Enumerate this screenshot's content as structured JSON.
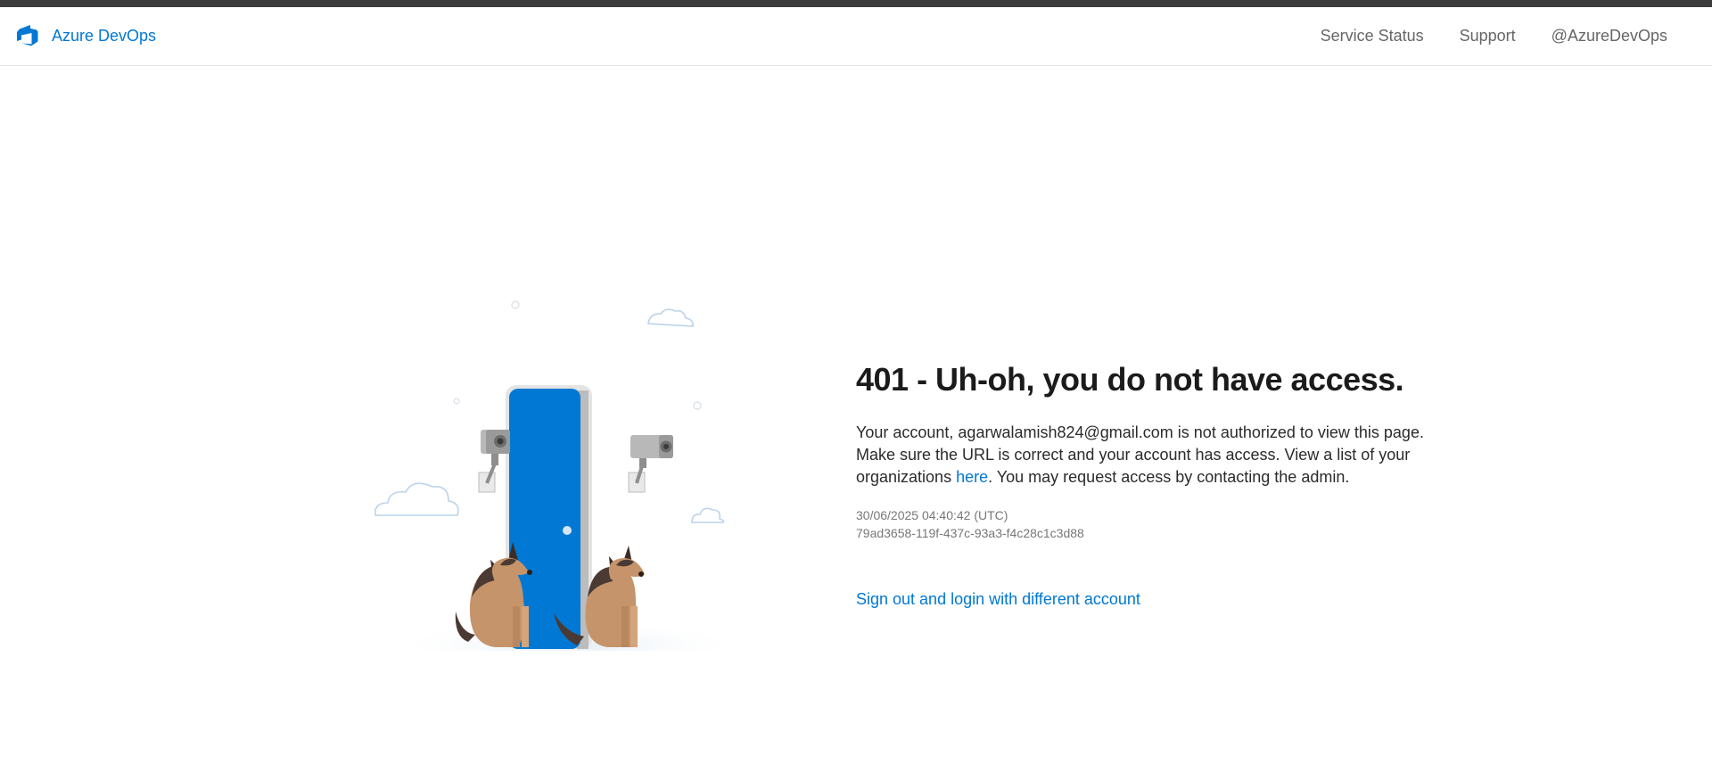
{
  "header": {
    "brand_name": "Azure DevOps",
    "nav": [
      {
        "label": "Service Status"
      },
      {
        "label": "Support"
      },
      {
        "label": "@AzureDevOps"
      }
    ]
  },
  "error": {
    "title": "401 - Uh-oh, you do not have access.",
    "message_prefix": "Your account, agarwalamish824@gmail.com is not authorized to view this page. Make sure the URL is correct and your account has access. View a list of your organizations ",
    "link_text": "here",
    "message_suffix": ". You may request access by contacting the admin.",
    "timestamp": "30/06/2025 04:40:42 (UTC)",
    "activity_id": "79ad3658-119f-437c-93a3-f4c28c1c3d88",
    "action_label": "Sign out and login with different account"
  },
  "colors": {
    "accent": "#0078d4",
    "top_strip": "#3c3c3c",
    "door": "#0078d4"
  },
  "icons": [
    "azure-devops-logo-icon"
  ]
}
